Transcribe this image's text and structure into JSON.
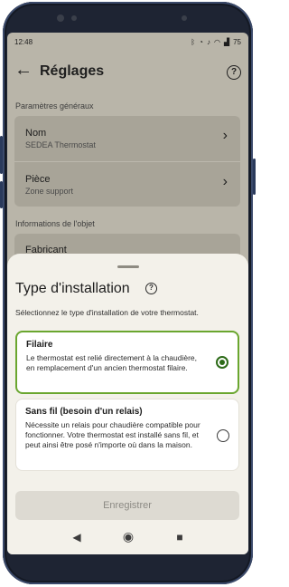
{
  "status_bar": {
    "time": "12:48",
    "icons": [
      "bluetooth-icon",
      "alarm-icon",
      "silent-icon",
      "wifi-icon",
      "signal-icon",
      "battery-icon"
    ],
    "battery": "75"
  },
  "header": {
    "title": "Réglages"
  },
  "general": {
    "section_label": "Paramètres généraux",
    "items": [
      {
        "title": "Nom",
        "subtitle": "SEDEA Thermostat"
      },
      {
        "title": "Pièce",
        "subtitle": "Zone support"
      }
    ]
  },
  "object_info": {
    "section_label": "Informations de l'objet",
    "items": [
      {
        "title": "Fabricant"
      }
    ]
  },
  "sheet": {
    "title": "Type d'installation",
    "description": "Sélectionnez le type d'installation de votre thermostat.",
    "options": [
      {
        "title": "Filaire",
        "description": "Le thermostat est relié directement à la chaudière, en remplacement d'un ancien thermostat filaire.",
        "selected": true
      },
      {
        "title": "Sans fil (besoin d'un relais)",
        "description": "Nécessite un relais pour chaudière compatible pour fonctionner. Votre thermostat est installé sans fil, et peut ainsi être posé n'importe où dans la maison.",
        "selected": false
      }
    ],
    "save_label": "Enregistrer"
  },
  "colors": {
    "accent": "#6aa62f",
    "radio_selected": "#2d6b18",
    "sheet_bg": "#f3f1ea"
  }
}
